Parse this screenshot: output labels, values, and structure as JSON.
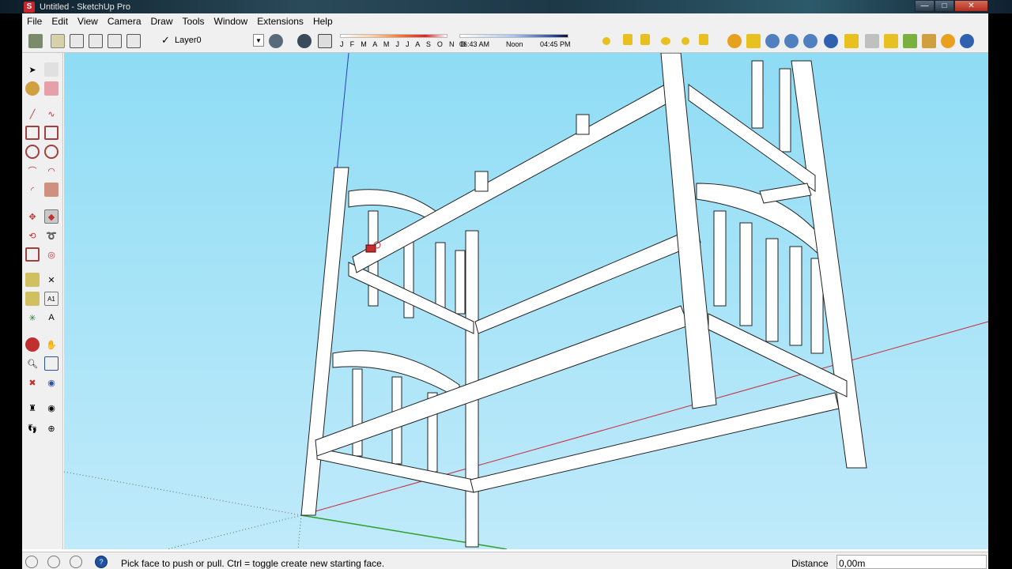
{
  "window": {
    "title": "Untitled - SketchUp Pro",
    "app_icon": "sketchup-logo-icon",
    "buttons": {
      "minimize": "—",
      "maximize": "□",
      "close": "✕"
    }
  },
  "menu": [
    "File",
    "Edit",
    "View",
    "Camera",
    "Draw",
    "Tools",
    "Window",
    "Extensions",
    "Help"
  ],
  "toolbar": {
    "layer_checkmark": "✓",
    "layer": "Layer0",
    "layer_dropdown": "▼",
    "months": "J F M A M J J A S O N D",
    "time_start": "06:43 AM",
    "time_mid": "Noon",
    "time_end": "04:45 PM"
  },
  "status": {
    "message": "Pick face to push or pull.  Ctrl = toggle create new starting face.",
    "vcb_label": "Distance",
    "vcb_value": "0,00m",
    "icons": [
      "geo-location-icon",
      "credits-icon",
      "user-icon",
      "help-icon"
    ],
    "help_glyph": "?"
  },
  "colors": {
    "sky_top": "#8fdcf5",
    "sky_bottom": "#bfeafa",
    "axis_red": "#c8283c",
    "axis_green": "#2ca02c",
    "axis_blue": "#2c3cc8",
    "model_face": "#ffffff"
  }
}
